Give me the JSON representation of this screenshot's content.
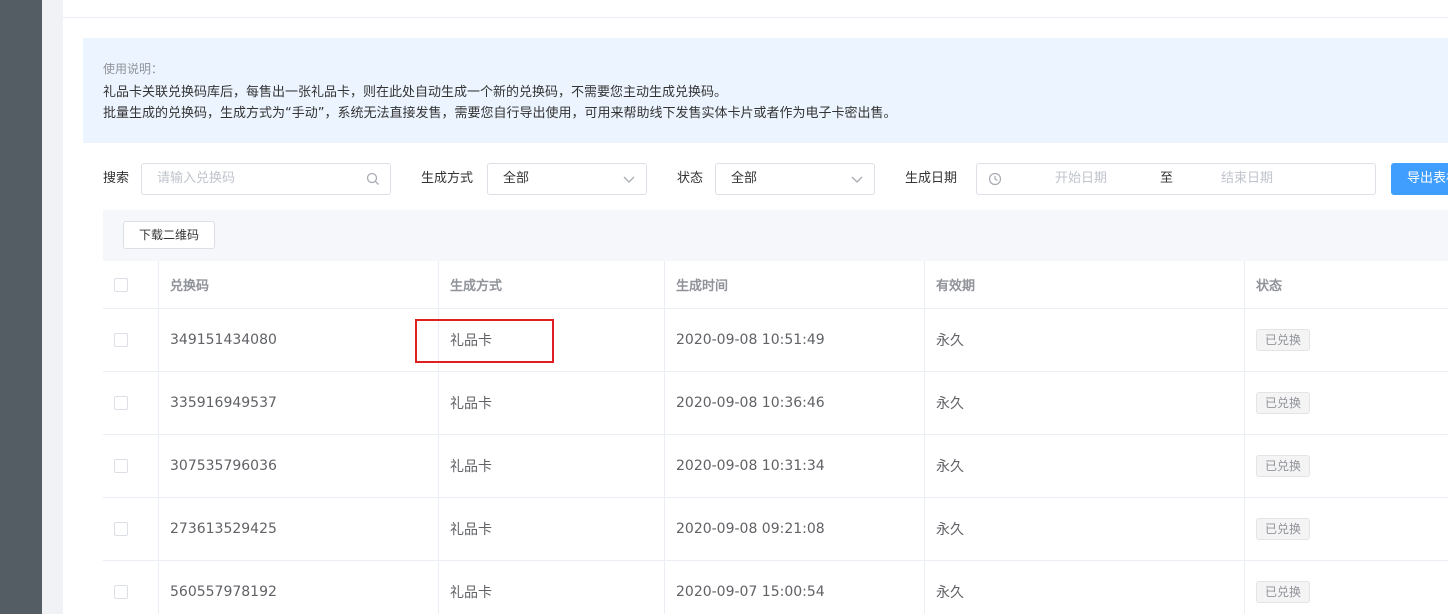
{
  "notice": {
    "title": "使用说明：",
    "line1": "礼品卡关联兑换码库后，每售出一张礼品卡，则在此处自动生成一个新的兑换码，不需要您主动生成兑换码。",
    "line2": "批量生成的兑换码，生成方式为“手动”，系统无法直接发售，需要您自行导出使用，可用来帮助线下发售实体卡片或者作为电子卡密出售。"
  },
  "filters": {
    "search_label": "搜索",
    "search_placeholder": "请输入兑换码",
    "method_label": "生成方式",
    "method_value": "全部",
    "status_label": "状态",
    "status_value": "全部",
    "date_label": "生成日期",
    "date_start_placeholder": "开始日期",
    "date_sep": "至",
    "date_end_placeholder": "结束日期",
    "export_label": "导出表格"
  },
  "toolbar": {
    "download_qr_label": "下载二维码"
  },
  "table": {
    "headers": {
      "code": "兑换码",
      "method": "生成方式",
      "time": "生成时间",
      "validity": "有效期",
      "status": "状态"
    },
    "rows": [
      {
        "code": "349151434080",
        "method": "礼品卡",
        "time": "2020-09-08 10:51:49",
        "validity": "永久",
        "status": "已兑换"
      },
      {
        "code": "335916949537",
        "method": "礼品卡",
        "time": "2020-09-08 10:36:46",
        "validity": "永久",
        "status": "已兑换"
      },
      {
        "code": "307535796036",
        "method": "礼品卡",
        "time": "2020-09-08 10:31:34",
        "validity": "永久",
        "status": "已兑换"
      },
      {
        "code": "273613529425",
        "method": "礼品卡",
        "time": "2020-09-08 09:21:08",
        "validity": "永久",
        "status": "已兑换"
      },
      {
        "code": "560557978192",
        "method": "礼品卡",
        "time": "2020-09-07 15:00:54",
        "validity": "永久",
        "status": "已兑换"
      }
    ]
  },
  "colors": {
    "accent": "#409eff",
    "highlight": "#e02020",
    "notice_bg": "#ecf5ff",
    "sidebar": "#545c64"
  }
}
